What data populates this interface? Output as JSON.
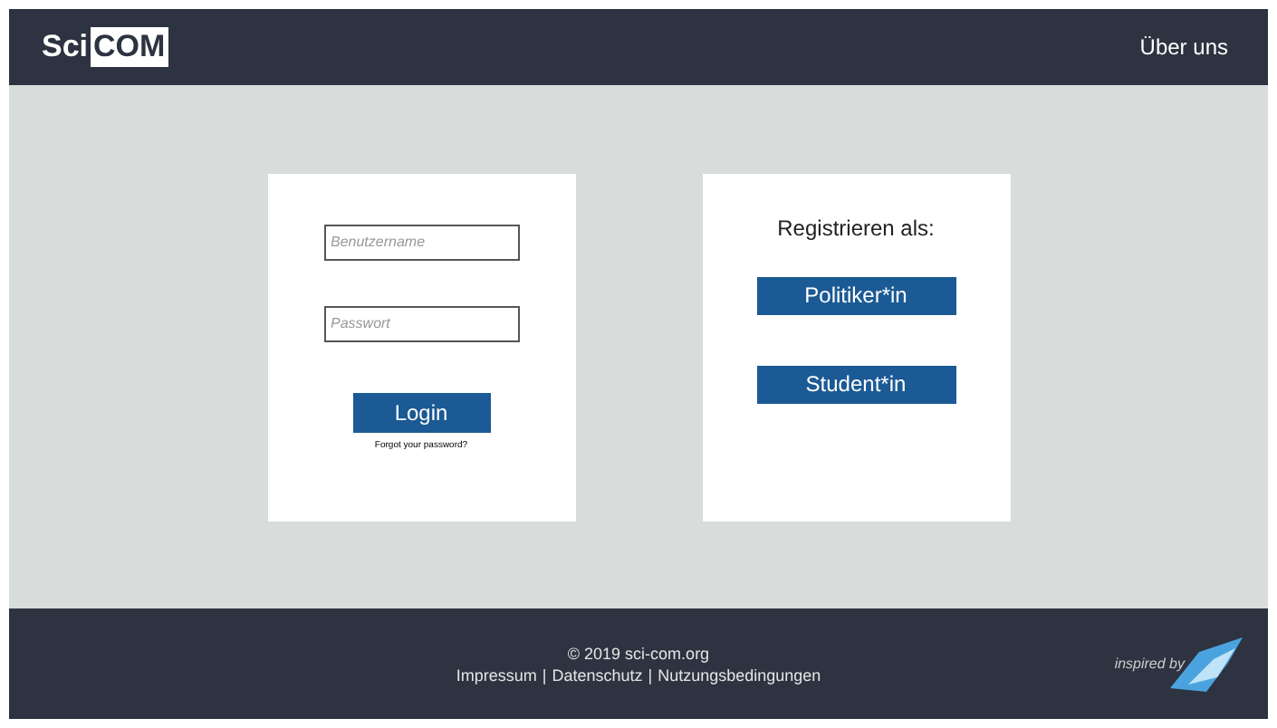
{
  "header": {
    "logo": {
      "part_1": "Sci",
      "part_2": "COM"
    },
    "nav": [
      "Über uns"
    ]
  },
  "login": {
    "fields": [
      {
        "placeholder": "Benutzername"
      },
      {
        "placeholder": "Passwort"
      }
    ],
    "button": "Login",
    "forgot_link": "Forgot your password?"
  },
  "register": {
    "title": "Registrieren als:",
    "buttons": [
      "Politiker*in",
      "Student*in"
    ]
  },
  "footer": {
    "copyright": "© 2019 sci-com.org",
    "links": [
      "Impressum",
      "Datenschutz",
      "Nutzungsbedingungen"
    ],
    "separator": "|",
    "badge": "inspired by"
  }
}
